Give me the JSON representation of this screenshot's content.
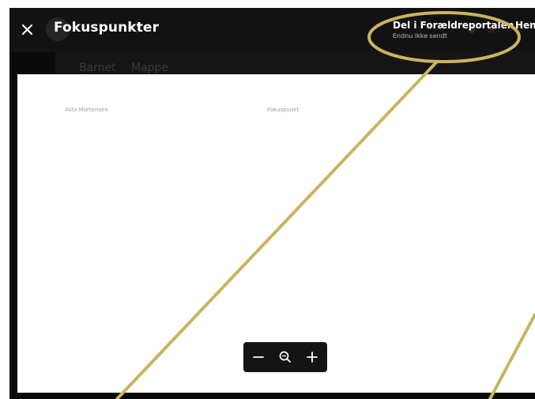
{
  "header": {
    "title": "Fokuspunkter",
    "close_icon": "close-icon",
    "share": {
      "label": "Del i Forældreportalen",
      "status": "Endnu ikke sendt"
    },
    "fetch_label": "Hent"
  },
  "background_app": {
    "title_fragment": "r",
    "tabs": [
      {
        "label": "Barnet"
      },
      {
        "label": "Mappe"
      }
    ]
  },
  "document": {
    "child_name": "Asta Mortensen",
    "column_label": "Fokuspunkt"
  },
  "zoom_controls": {
    "zoom_out_icon": "minus-icon",
    "zoom_icon": "magnifier-icon",
    "zoom_in_icon": "plus-icon"
  },
  "colors": {
    "annotation": "#c9b45f",
    "overlay": "#0a0a0a",
    "page": "#ffffff"
  }
}
